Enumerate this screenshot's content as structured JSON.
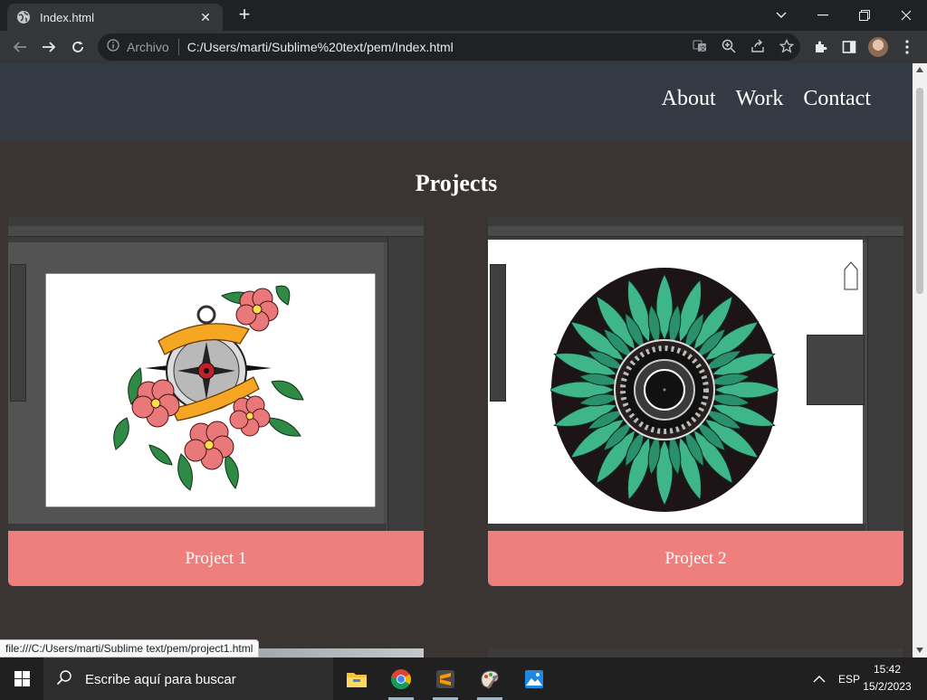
{
  "browser": {
    "tab": {
      "title": "Index.html",
      "favicon": "globe-icon"
    },
    "omnibox": {
      "security_label": "Archivo",
      "url": "C:/Users/marti/Sublime%20text/pem/Index.html"
    },
    "status_url": "file:///C:/Users/marti/Sublime text/pem/project1.html"
  },
  "site": {
    "nav": [
      "About",
      "Work",
      "Contact"
    ],
    "section_title": "Projects",
    "projects": [
      {
        "caption": "Project 1",
        "image": "compass-flower-illustration"
      },
      {
        "caption": "Project 2",
        "image": "mandala-illustration"
      }
    ]
  },
  "taskbar": {
    "search_placeholder": "Escribe aquí para buscar",
    "language": "ESP",
    "time": "15:42",
    "date": "15/2/2023",
    "apps": [
      "file-explorer-icon",
      "chrome-icon",
      "sublime-text-icon",
      "paint-icon",
      "photos-icon"
    ]
  },
  "colors": {
    "header_bg": "#333a43",
    "page_bg": "#3a3533",
    "caption_bg": "#ef7f7d",
    "chrome_dark": "#202124",
    "chrome_mid": "#35363a"
  }
}
